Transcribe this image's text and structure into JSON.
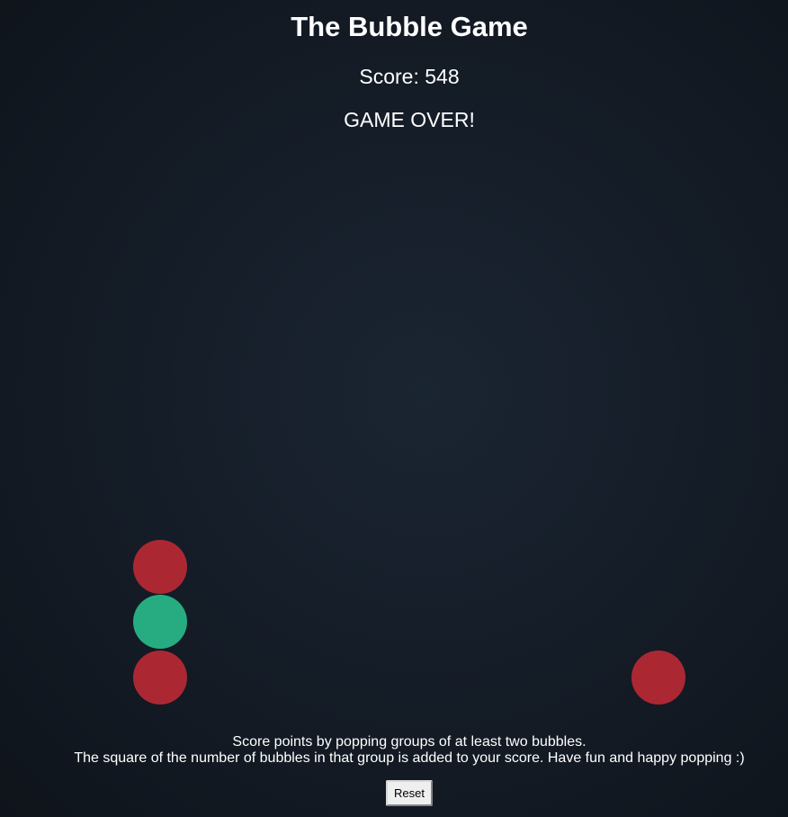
{
  "header": {
    "title": "The Bubble Game",
    "score_text": "Score: 548",
    "status": "GAME OVER!"
  },
  "bubble_colors": {
    "red": "#ab2833",
    "green": "#27ac82"
  },
  "board": {
    "bubbles": [
      {
        "color": "red",
        "col": 0,
        "row": 2
      },
      {
        "color": "green",
        "col": 0,
        "row": 1
      },
      {
        "color": "red",
        "col": 0,
        "row": 0
      },
      {
        "color": "red",
        "col": 9,
        "row": 0
      }
    ]
  },
  "instructions": {
    "line1": "Score points by popping groups of at least two bubbles.",
    "line2": "The square of the number of bubbles in that group is added to your score. Have fun and happy popping :)"
  },
  "controls": {
    "reset_label": "Reset"
  }
}
